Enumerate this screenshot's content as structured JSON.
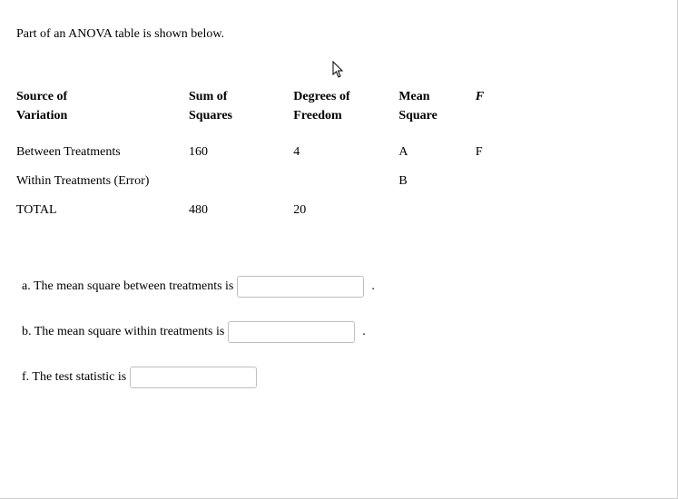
{
  "intro": "Part of an ANOVA table is shown below.",
  "headers": {
    "source_l1": "Source of",
    "source_l2": "Variation",
    "ss_l1": "Sum of",
    "ss_l2": "Squares",
    "df_l1": "Degrees of",
    "df_l2": "Freedom",
    "ms_l1": "Mean",
    "ms_l2": "Square",
    "f": "F"
  },
  "rows": {
    "between": {
      "source": "Between Treatments",
      "ss": "160",
      "df": "4",
      "ms": "A",
      "f": "F"
    },
    "within": {
      "source": "Within Treatments (Error)",
      "ss": "",
      "df": "",
      "ms": "B",
      "f": ""
    },
    "total": {
      "source": "TOTAL",
      "ss": "480",
      "df": "20",
      "ms": "",
      "f": ""
    }
  },
  "questions": {
    "a_label": "a. The mean square between treatments is",
    "a_value": "",
    "a_after": ".",
    "b_label": "b. The mean square within treatments is",
    "b_value": "",
    "b_after": ".",
    "f_label": "f. The test statistic is",
    "f_value": "",
    "f_after": ""
  },
  "cursor_name": "cursor-arrow-icon",
  "chart_data": {
    "type": "table",
    "title": "ANOVA table (partial)",
    "columns": [
      "Source of Variation",
      "Sum of Squares",
      "Degrees of Freedom",
      "Mean Square",
      "F"
    ],
    "rows": [
      [
        "Between Treatments",
        160,
        4,
        "A",
        "F"
      ],
      [
        "Within Treatments (Error)",
        null,
        null,
        "B",
        null
      ],
      [
        "TOTAL",
        480,
        20,
        null,
        null
      ]
    ]
  }
}
